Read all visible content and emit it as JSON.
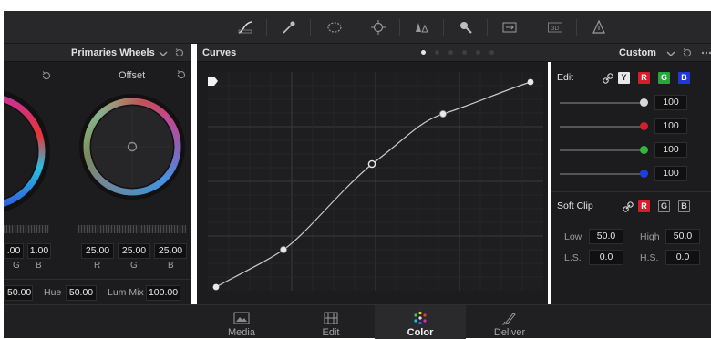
{
  "toolbar": {
    "icons": [
      "curves-tool-icon",
      "eyedropper-icon",
      "window-ellipse-icon",
      "tracker-icon",
      "blur-icon",
      "key-icon",
      "sizing-icon",
      "3d-icon",
      "magic-mask-icon"
    ]
  },
  "primaries": {
    "title": "Primaries Wheels",
    "offset_label": "Offset",
    "partial_values": [
      ".00",
      "1.00"
    ],
    "partial_channels": [
      "G",
      "B"
    ],
    "offset_values": [
      "25.00",
      "25.00",
      "25.00"
    ],
    "offset_channels": [
      "R",
      "G",
      "B"
    ],
    "bottom": {
      "sat_value": "50.00",
      "hue_label": "Hue",
      "hue_value": "50.00",
      "lummix_label": "Lum Mix",
      "lummix_value": "100.00"
    }
  },
  "curves": {
    "title": "Curves",
    "mode": "Custom",
    "page_dots": 6
  },
  "edit": {
    "label": "Edit",
    "channel_chips": [
      "Y",
      "R",
      "G",
      "B"
    ],
    "sliders": [
      {
        "channel": "Y",
        "color": "#d8d8d8",
        "value": "100"
      },
      {
        "channel": "R",
        "color": "#d0202a",
        "value": "100"
      },
      {
        "channel": "G",
        "color": "#2fb83a",
        "value": "100"
      },
      {
        "channel": "B",
        "color": "#1e3fe0",
        "value": "100"
      }
    ]
  },
  "softclip": {
    "label": "Soft Clip",
    "chips": [
      "R",
      "G",
      "B"
    ],
    "low_label": "Low",
    "low_value": "50.0",
    "high_label": "High",
    "high_value": "50.0",
    "ls_label": "L.S.",
    "ls_value": "0.0",
    "hs_label": "H.S.",
    "hs_value": "0.0"
  },
  "pages": [
    {
      "label": "Media",
      "icon": "media-icon",
      "active": false
    },
    {
      "label": "Edit",
      "icon": "edit-page-icon",
      "active": false
    },
    {
      "label": "Color",
      "icon": "color-icon",
      "active": true
    },
    {
      "label": "Deliver",
      "icon": "deliver-icon",
      "active": false
    }
  ],
  "colors": {
    "accent": "#e0202a",
    "panel_bg": "#1c1c1e",
    "header_bg": "#28282a"
  }
}
